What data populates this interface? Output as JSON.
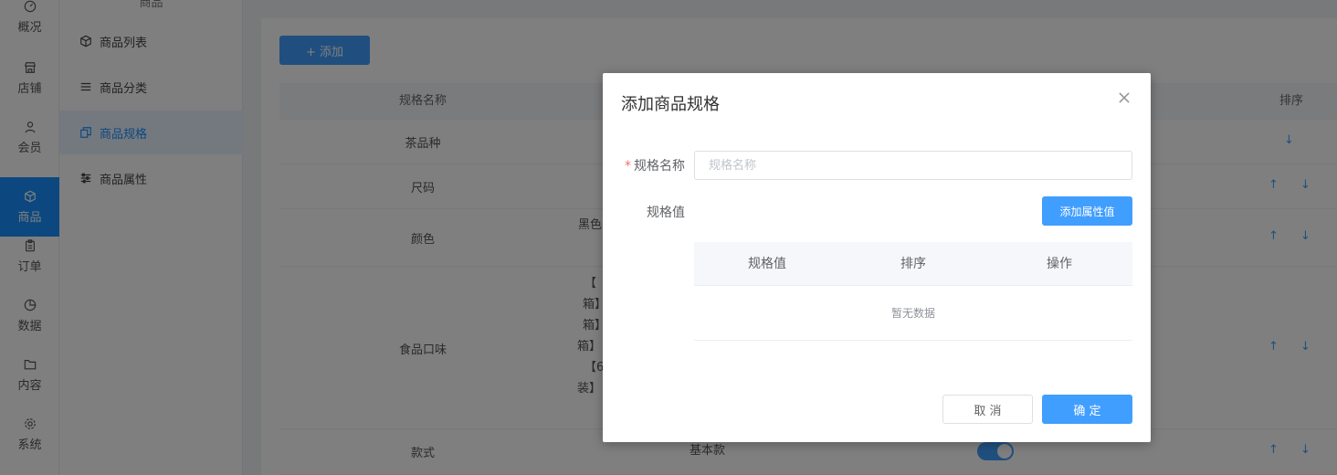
{
  "rail": {
    "items": [
      {
        "label": "概况",
        "icon": "dashboard-icon"
      },
      {
        "label": "店铺",
        "icon": "shop-icon"
      },
      {
        "label": "会员",
        "icon": "user-icon"
      },
      {
        "label": "商品",
        "icon": "box-icon",
        "active": true
      },
      {
        "label": "订单",
        "icon": "clipboard-icon"
      },
      {
        "label": "数据",
        "icon": "pie-chart-icon"
      },
      {
        "label": "内容",
        "icon": "folder-icon"
      },
      {
        "label": "系统",
        "icon": "gear-icon"
      }
    ]
  },
  "subnav": {
    "heading": "商品",
    "items": [
      {
        "label": "商品列表",
        "icon": "box-icon"
      },
      {
        "label": "商品分类",
        "icon": "list-icon"
      },
      {
        "label": "商品规格",
        "icon": "copy-icon",
        "active": true
      },
      {
        "label": "商品属性",
        "icon": "sliders-icon"
      }
    ]
  },
  "main": {
    "add_button": "+ 添加",
    "table": {
      "headers": {
        "name": "规格名称",
        "sort": "排序"
      },
      "rows": [
        {
          "name": "茶品种",
          "arrows": "↓"
        },
        {
          "name": "尺码",
          "arrows": "↑ ↓"
        },
        {
          "name": "颜色",
          "values_fragment": "黑色",
          "arrows": "↑ ↓"
        },
        {
          "name": "食品口味",
          "values_fragment_lines": [
            "【",
            "箱】",
            "箱】",
            "箱】",
            "【6",
            "装】"
          ],
          "arrows": "↑ ↓"
        },
        {
          "name": "款式",
          "values_fragment": "基本款",
          "arrows": "↑ ↓"
        }
      ]
    }
  },
  "dialog": {
    "title": "添加商品规格",
    "name_label": "规格名称",
    "required_mark": "*",
    "name_placeholder": "规格名称",
    "value_label": "规格值",
    "add_attr_button": "添加属性值",
    "inner_table": {
      "headers": [
        "规格值",
        "排序",
        "操作"
      ],
      "empty_text": "暂无数据"
    },
    "cancel_button": "取 消",
    "confirm_button": "确 定"
  },
  "colors": {
    "primary": "#409eff",
    "nav_active": "#1890ff",
    "required": "#f56c6c"
  }
}
